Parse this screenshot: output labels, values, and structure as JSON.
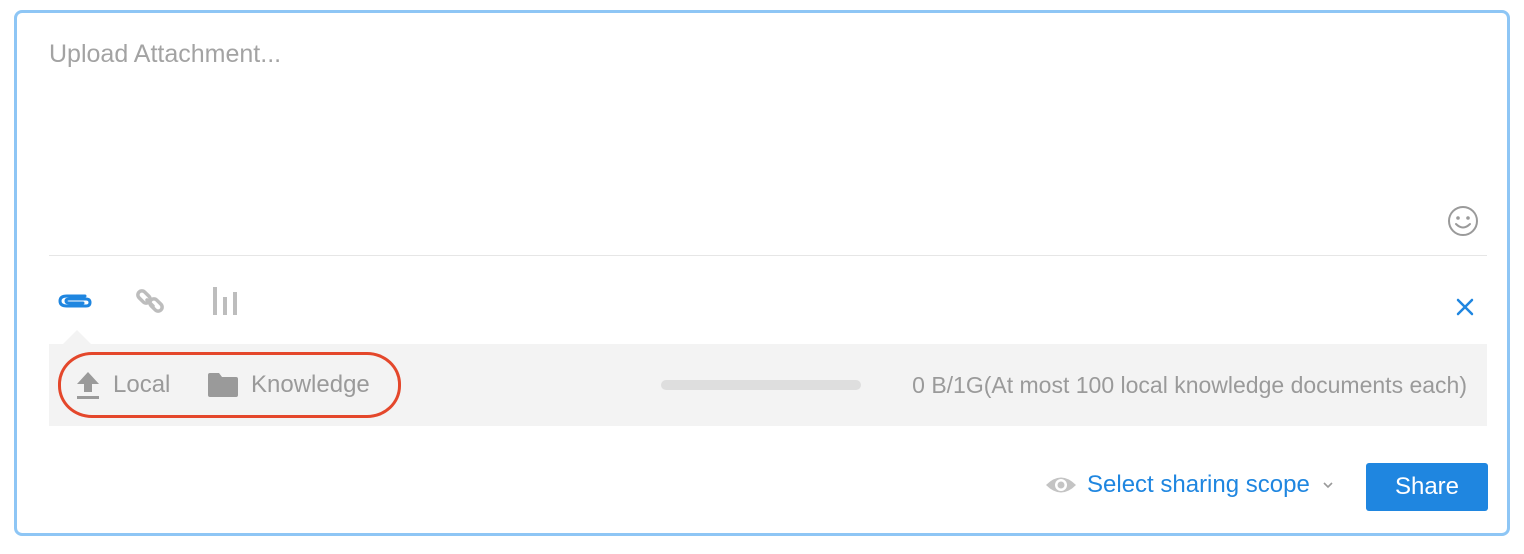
{
  "composer": {
    "placeholder": "Upload Attachment...",
    "value": ""
  },
  "toolbar": {
    "icons": [
      "paperclip-icon",
      "link-icon",
      "chart-icon"
    ],
    "active": "paperclip-icon"
  },
  "upload": {
    "local_label": "Local",
    "knowledge_label": "Knowledge",
    "progress": 0,
    "quota_text": "0 B/1G(At most 100 local knowledge documents each)"
  },
  "footer": {
    "scope_label": "Select sharing scope",
    "share_label": "Share"
  },
  "colors": {
    "accent": "#1f86e0",
    "border": "#8ec6f5",
    "highlight": "#e4472b",
    "muted": "#9a9a9a",
    "panel": "#f3f3f3"
  }
}
